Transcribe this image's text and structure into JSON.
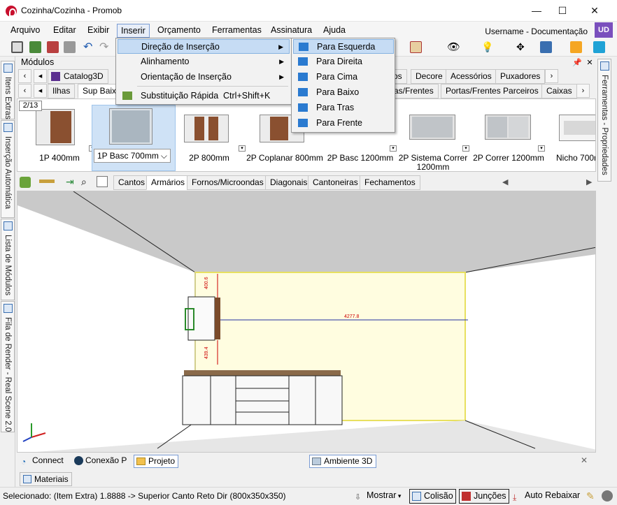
{
  "window": {
    "title": "Cozinha/Cozinha - Promob",
    "min": "—",
    "max": "☐",
    "close": "✕"
  },
  "menubar": {
    "items": [
      "Arquivo",
      "Editar",
      "Exibir",
      "Inserir",
      "Orçamento",
      "Ferramentas",
      "Assinatura",
      "Ajuda"
    ]
  },
  "user": {
    "label": "Username - Documentação",
    "initials": "UD"
  },
  "left_dock_tabs": [
    "Itens Extras",
    "Inserção Automática",
    "Lista de Módulos",
    "Fila de Render - Real Scene 2.0"
  ],
  "right_dock_tabs": [
    "Ferramentas - Propriedades"
  ],
  "panel": {
    "title": "Módulos",
    "pin": "📌",
    "close": "✕"
  },
  "category_tabs_row1": {
    "catalog": "Catalog3D",
    "visible_tabs": [
      "os",
      "Decore",
      "Acessórios",
      "Puxadores"
    ]
  },
  "category_tabs_row2": {
    "tabs": [
      "Ilhas",
      "Sup Baixo"
    ],
    "right_tabs": [
      "as/Frentes",
      "Portas/Frentes Parceiros",
      "Caixas"
    ]
  },
  "gallery": {
    "page": "2/13",
    "items": [
      {
        "label": "1P 400mm",
        "style": "wood"
      },
      {
        "label": "1P Basc 700mm",
        "style": "glass"
      },
      {
        "label": "2P 800mm",
        "style": "wood"
      },
      {
        "label": "2P Coplanar 800mm",
        "style": "wood"
      },
      {
        "label": "2P Basc 1200mm",
        "style": "wood"
      },
      {
        "label": "2P Sistema Correr 1200mm",
        "style": "grey"
      },
      {
        "label": "2P Correr 1200mm",
        "style": "grey"
      },
      {
        "label": "Nicho 700m",
        "style": "white"
      }
    ]
  },
  "subtabs": [
    "Cantos",
    "Armários",
    "Fornos/Microondas",
    "Diagonais",
    "Cantoneiras",
    "Fechamentos"
  ],
  "viewport": {
    "dimension_width": "4277.8",
    "dimension_top": "400.6",
    "dimension_bottom": "439.4"
  },
  "bottom_tabs": {
    "connect": "Connect",
    "conexao": "Conexão P",
    "projeto": "Projeto",
    "ambiente": "Ambiente 3D",
    "close": "✕"
  },
  "materiais": "Materiais",
  "status": {
    "selected": "Selecionado: (Item Extra) 1.8888 -> Superior Canto Reto Dir (800x350x350)",
    "mostrar": "Mostrar",
    "colisao": "Colisão",
    "juncoes": "Junções",
    "auto_rebaixar": "Auto Rebaixar"
  },
  "inserir_menu": {
    "items": [
      {
        "label": "Direção de Inserção",
        "shortcut": "",
        "submenu": true
      },
      {
        "label": "Alinhamento",
        "shortcut": "",
        "submenu": true
      },
      {
        "label": "Orientação de Inserção",
        "shortcut": "",
        "submenu": true
      },
      {
        "label": "Substituição Rápida",
        "shortcut": "Ctrl+Shift+K",
        "submenu": false
      }
    ]
  },
  "direction_submenu": {
    "items": [
      "Para Esquerda",
      "Para Direita",
      "Para Cima",
      "Para Baixo",
      "Para Tras",
      "Para Frente"
    ]
  },
  "colors": {
    "accent": "#3a6fb0",
    "menu_highlight": "#c6dcf4",
    "wall_yellow": "#fffde0",
    "wood": "#8a5030",
    "user_badge": "#7a4fbd"
  }
}
